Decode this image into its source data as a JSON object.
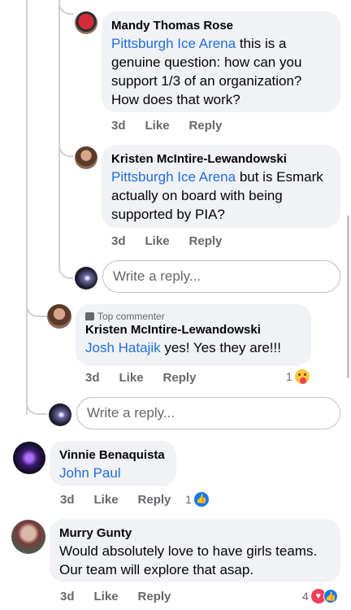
{
  "comments": [
    {
      "author": "Mandy Thomas Rose",
      "mention": "Pittsburgh Ice Arena",
      "text": " this is a genuine question: how can you support 1/3 of an organization? How does that work?",
      "time": "3d",
      "like": "Like",
      "reply": "Reply"
    },
    {
      "author": "Kristen McIntire-Lewandowski",
      "mention": "Pittsburgh Ice Arena",
      "text": " but is Esmark actually on board with being supported by PIA?",
      "time": "3d",
      "like": "Like",
      "reply": "Reply"
    },
    {
      "badge": "Top commenter",
      "author": "Kristen McIntire-Lewandowski",
      "mention": "Josh Hatajik",
      "text": " yes!  Yes they are!!!",
      "time": "3d",
      "like": "Like",
      "reply": "Reply",
      "reaction_count": "1",
      "reaction_icon": "care-emoji-icon"
    },
    {
      "author": "Vinnie Benaquista",
      "mention": "John Paul",
      "text": "",
      "time": "3d",
      "like": "Like",
      "reply": "Reply",
      "reaction_count": "1",
      "reaction_icon": "like-icon"
    },
    {
      "author": "Murry Gunty",
      "text": "Would absolutely love to have girls teams. Our team will explore that asap.",
      "time": "3d",
      "like": "Like",
      "reply": "Reply",
      "reaction_count": "4",
      "reaction_icon": "love-like-icons"
    }
  ],
  "reply_box": {
    "placeholder": "Write a reply..."
  },
  "colors": {
    "mention": "#216fdb",
    "like_blue": "#1877f2",
    "love_red": "#f33e58",
    "bubble": "#f0f2f5"
  }
}
